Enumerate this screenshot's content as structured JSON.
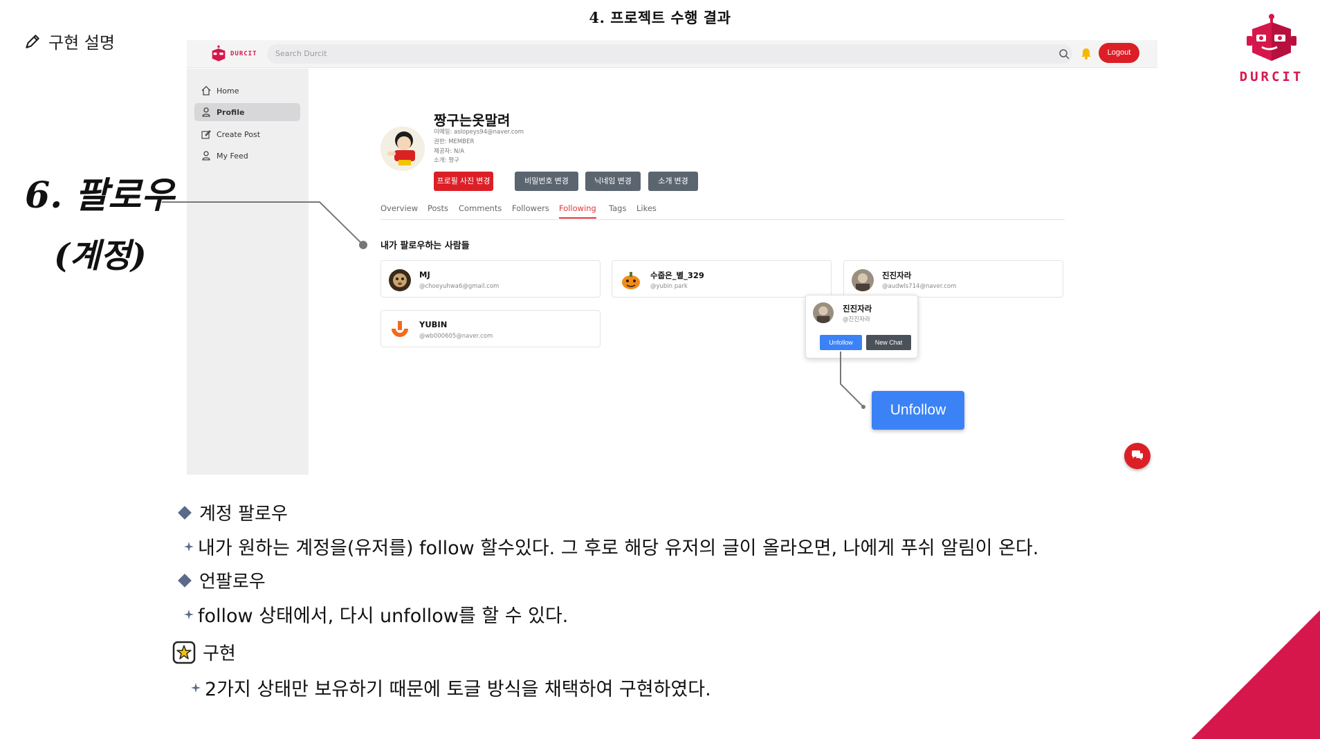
{
  "slide": {
    "title": "4. 프로젝트 수행 결과",
    "section_label": "구현 설명",
    "handwritten": [
      "6. 팔로우",
      "(계정)"
    ],
    "brand": "DURCIT"
  },
  "app": {
    "logo_text": "DURCIT",
    "search_placeholder": "Search Durcit",
    "logout_label": "Logout",
    "sidebar": [
      {
        "label": "Home",
        "icon": "home-icon"
      },
      {
        "label": "Profile",
        "icon": "user-icon",
        "active": true
      },
      {
        "label": "Create Post",
        "icon": "edit-icon"
      },
      {
        "label": "My Feed",
        "icon": "user-icon"
      }
    ],
    "profile": {
      "name": "짱구는옷말려",
      "email": "이메일: aslopeys94@naver.com",
      "role": "권한: MEMBER",
      "provider": "제공자: N/A",
      "intro": "소개: 짱구"
    },
    "profile_buttons": [
      "프로필 사진 변경",
      "비밀번호 변경",
      "닉네임 변경",
      "소개 변경"
    ],
    "tabs": [
      "Overview",
      "Posts",
      "Comments",
      "Followers",
      "Following",
      "Tags",
      "Likes"
    ],
    "active_tab": "Following",
    "following_heading": "내가 팔로우하는 사람들",
    "following": [
      {
        "name": "MJ",
        "handle": "@choeyuhwa6@gmail.com"
      },
      {
        "name": "수줍은_별_329",
        "handle": "@yubin park"
      },
      {
        "name": "진진자라",
        "handle": "@audwls714@naver.com"
      },
      {
        "name": "YUBIN",
        "handle": "@wb000605@naver.com"
      }
    ],
    "popup": {
      "name": "진진자라",
      "handle": "@진진자라",
      "unfollow_label": "Unfollow",
      "new_chat_label": "New Chat"
    },
    "big_unfollow_label": "Unfollow",
    "colors": {
      "brand": "#d6174b",
      "logout": "#dc1f26",
      "unfollow": "#3b82f6",
      "active_tab": "#e3343b"
    }
  },
  "description": {
    "item1_title": "계정 팔로우",
    "item1_text": "내가 원하는 계정을(유저를) follow 할수있다. 그 후로 해당 유저의 글이 올라오면, 나에게 푸쉬 알림이 온다.",
    "item2_title": "언팔로우",
    "item2_text": "follow 상태에서, 다시 unfollow를 할 수 있다.",
    "impl_title": "구현",
    "impl_text": "2가지 상태만 보유하기 때문에 토글 방식을 채택하여 구현하였다."
  }
}
